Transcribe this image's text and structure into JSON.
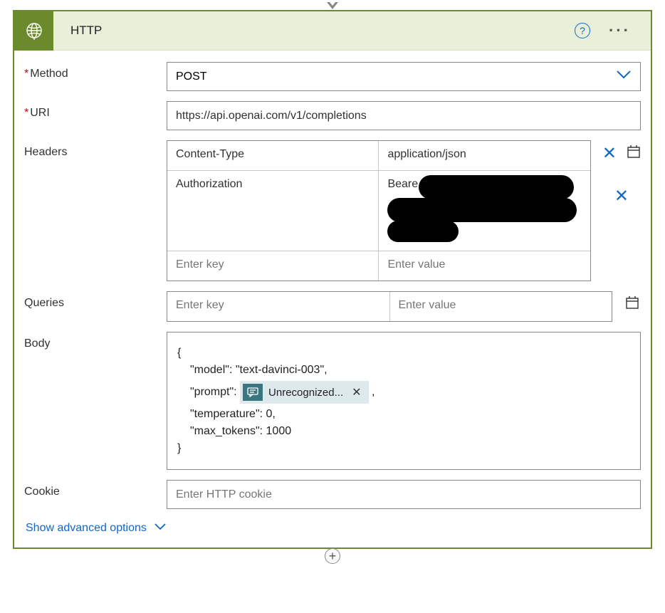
{
  "header": {
    "title": "HTTP",
    "icon_name": "globe-icon"
  },
  "fields": {
    "method": {
      "label": "Method",
      "value": "POST",
      "required": true
    },
    "uri": {
      "label": "URI",
      "value": "https://api.openai.com/v1/completions",
      "required": true
    },
    "headers": {
      "label": "Headers",
      "rows": [
        {
          "key": "Content-Type",
          "value": "application/json"
        },
        {
          "key": "Authorization",
          "value": "Beare"
        }
      ],
      "placeholder_key": "Enter key",
      "placeholder_value": "Enter value"
    },
    "queries": {
      "label": "Queries",
      "placeholder_key": "Enter key",
      "placeholder_value": "Enter value"
    },
    "body": {
      "label": "Body",
      "open_brace": "{",
      "line_model": "\"model\": \"text-davinci-003\",",
      "line_prompt_pre": "\"prompt\": ",
      "chip_label": "Unrecognized...",
      "line_prompt_post": ",",
      "line_temp": "\"temperature\": 0,",
      "line_max": "\"max_tokens\": 1000",
      "close_brace": "}"
    },
    "cookie": {
      "label": "Cookie",
      "placeholder": "Enter HTTP cookie"
    }
  },
  "advanced_label": "Show advanced options"
}
